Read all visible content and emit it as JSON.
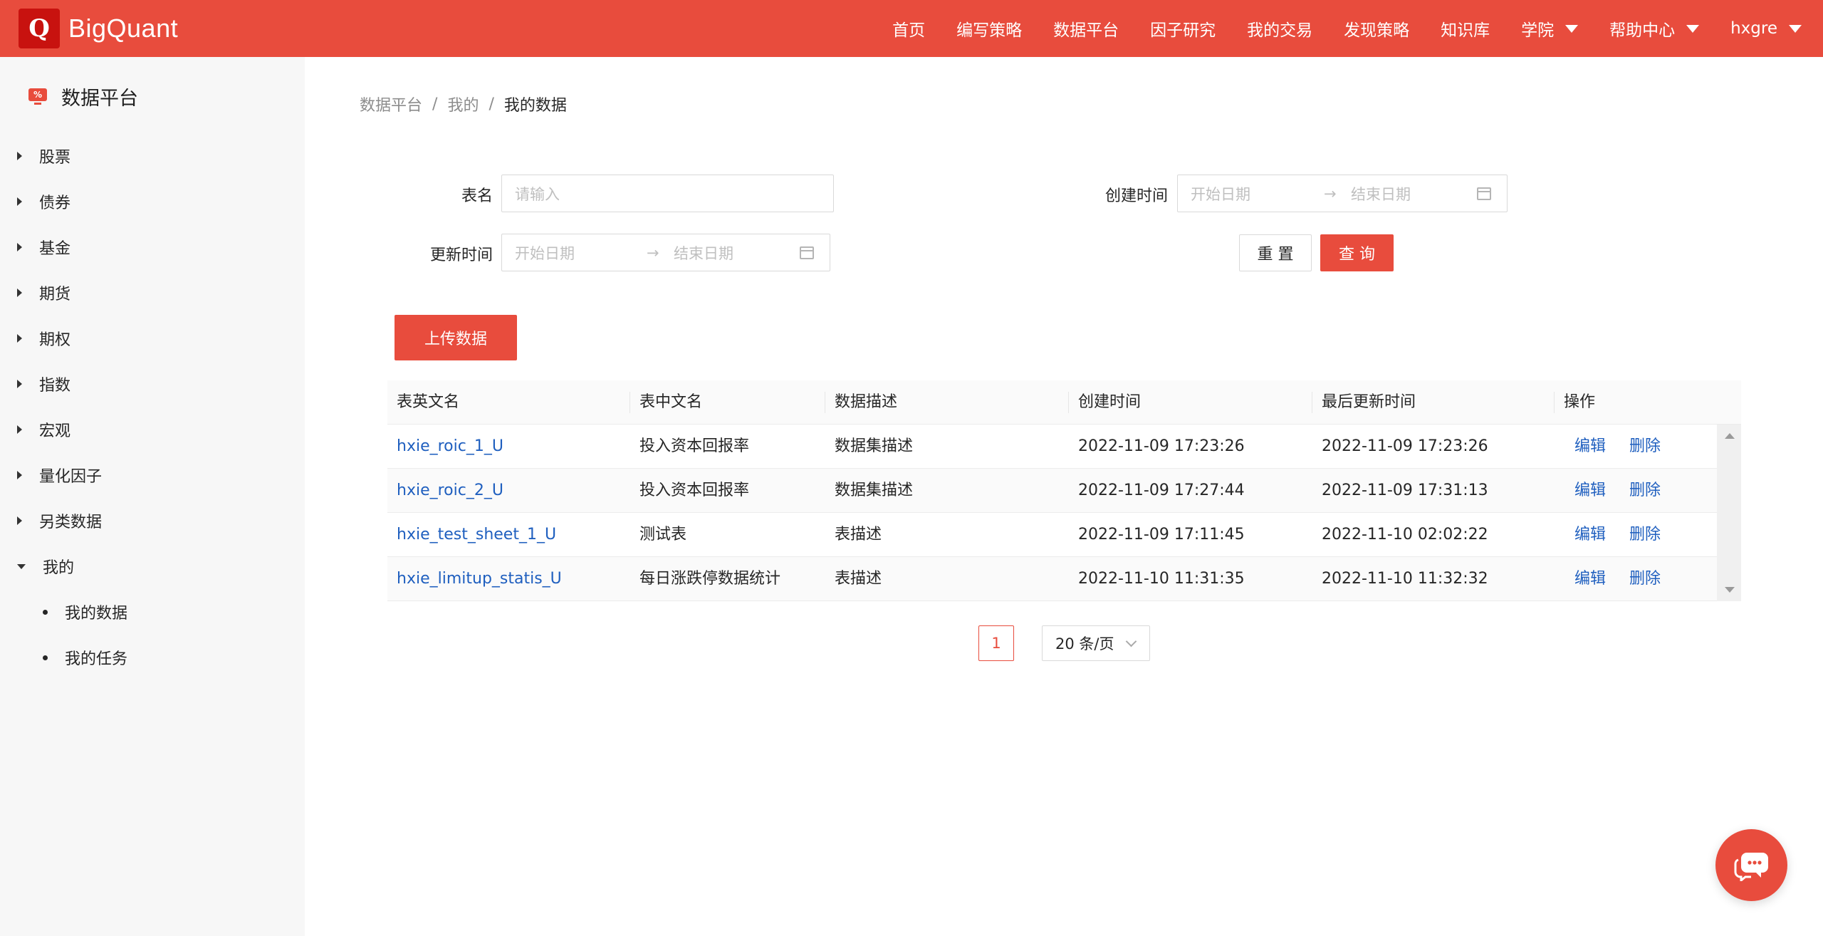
{
  "app": {
    "logo_letter": "Q",
    "logo_text": "BigQuant",
    "brand_color": "#e84c3d"
  },
  "nav": {
    "items": [
      "首页",
      "编写策略",
      "数据平台",
      "因子研究",
      "我的交易",
      "发现策略",
      "知识库"
    ],
    "academy": "学院",
    "help": "帮助中心",
    "user": "hxgre"
  },
  "sidebar": {
    "title": "数据平台",
    "title_icon": "percent-monitor-icon",
    "items": [
      "股票",
      "债券",
      "基金",
      "期货",
      "期权",
      "指数",
      "宏观",
      "量化因子",
      "另类数据",
      "我的"
    ],
    "sub_items": [
      "我的数据",
      "我的任务"
    ]
  },
  "breadcrumb": {
    "items": [
      "数据平台",
      "我的",
      "我的数据"
    ],
    "separator": "/"
  },
  "form": {
    "table_name_label": "表名",
    "table_name_placeholder": "请输入",
    "create_time_label": "创建时间",
    "update_time_label": "更新时间",
    "start_placeholder": "开始日期",
    "end_placeholder": "结束日期",
    "range_arrow": "→",
    "reset_label": "重 置",
    "query_label": "查 询"
  },
  "upload_label": "上传数据",
  "table": {
    "columns": [
      "表英文名",
      "表中文名",
      "数据描述",
      "创建时间",
      "最后更新时间",
      "操作"
    ],
    "rows": [
      {
        "en": "hxie_roic_1_U",
        "cn": "投入资本回报率",
        "desc": "数据集描述",
        "created": "2022-11-09 17:23:26",
        "updated": "2022-11-09 17:23:26"
      },
      {
        "en": "hxie_roic_2_U",
        "cn": "投入资本回报率",
        "desc": "数据集描述",
        "created": "2022-11-09 17:27:44",
        "updated": "2022-11-09 17:31:13"
      },
      {
        "en": "hxie_test_sheet_1_U",
        "cn": "测试表",
        "desc": "表描述",
        "created": "2022-11-09 17:11:45",
        "updated": "2022-11-10 02:02:22"
      },
      {
        "en": "hxie_limitup_statis_U",
        "cn": "每日涨跌停数据统计",
        "desc": "表描述",
        "created": "2022-11-10 11:31:35",
        "updated": "2022-11-10 11:32:32"
      }
    ],
    "edit_label": "编辑",
    "delete_label": "删除"
  },
  "pagination": {
    "current_page": "1",
    "page_size": "20 条/页"
  }
}
